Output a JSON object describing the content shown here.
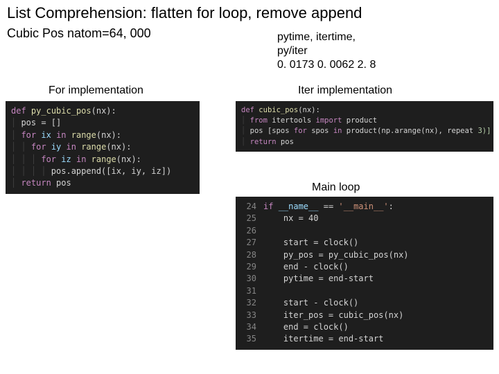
{
  "title": "List Comprehension: flatten for loop, remove append",
  "subtitle": "Cubic Pos natom=64, 000",
  "stats": {
    "line1": "pytime, itertime,",
    "line2": "py/iter",
    "line3": "0. 0173   0. 0062  2. 8"
  },
  "headings": {
    "left": "For implementation",
    "right": "Iter implementation",
    "mainloop": "Main loop"
  },
  "code_left": {
    "l1_def": "def",
    "l1_name": "py_cubic_pos",
    "l1_arg": "(nx):",
    "l2": "pos = []",
    "l3_for": "for",
    "l3_var": "ix",
    "l3_in": "in",
    "l3_call": "range",
    "l3_rest": "(nx):",
    "l4_for": "for",
    "l4_var": "iy",
    "l4_in": "in",
    "l4_call": "range",
    "l4_rest": "(nx):",
    "l5_for": "for",
    "l5_var": "iz",
    "l5_in": "in",
    "l5_call": "range",
    "l5_rest": "(nx):",
    "l6": "pos.append([ix, iy, iz])",
    "l7_ret": "return",
    "l7_var": "pos"
  },
  "code_right_top": {
    "l1_def": "def",
    "l1_name": "cubic_pos",
    "l1_arg": "(nx):",
    "l2_from": "from",
    "l2_mod": "itertools",
    "l2_import": "import",
    "l2_name": "product",
    "l3a": "pos",
    "l3b": "[spos",
    "l3_for": "for",
    "l3c": "spos",
    "l3_in": "in",
    "l3d": "product(np.arange(nx), repeat",
    "l3e": "3)]",
    "l4_ret": "return",
    "l4_var": "pos"
  },
  "code_right_bot": {
    "ln": [
      "24",
      "25",
      "26",
      "27",
      "28",
      "29",
      "30",
      "31",
      "32",
      "33",
      "34",
      "35"
    ],
    "l24_if": "if",
    "l24_name": "__name__",
    "l24_eq": "==",
    "l24_str": "'__main__'",
    "l24_colon": ":",
    "l25": "nx = 40",
    "l27": "start = clock()",
    "l28": "py_pos = py_cubic_pos(nx)",
    "l29": "end - clock()",
    "l30": "pytime = end-start",
    "l32": "start - clock()",
    "l33": "iter_pos = cubic_pos(nx)",
    "l34": "end = clock()",
    "l35": "itertime = end-start"
  }
}
